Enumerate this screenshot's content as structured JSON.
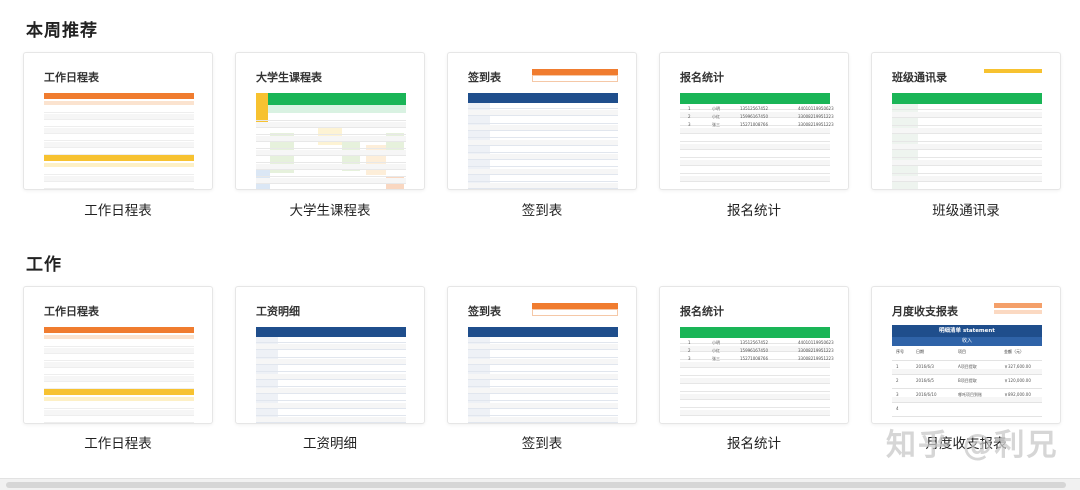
{
  "sections": [
    {
      "title": "本周推荐",
      "cards": [
        {
          "label": "工作日程表",
          "thumb_title": "工作日程表",
          "thumb_kind": "schedule"
        },
        {
          "label": "大学生课程表",
          "thumb_title": "大学生课程表",
          "thumb_kind": "timetable"
        },
        {
          "label": "签到表",
          "thumb_title": "签到表",
          "thumb_kind": "signin"
        },
        {
          "label": "报名统计",
          "thumb_title": "报名统计",
          "thumb_kind": "signup"
        },
        {
          "label": "班级通讯录",
          "thumb_title": "班级通讯录",
          "thumb_kind": "contacts"
        }
      ]
    },
    {
      "title": "工作",
      "cards": [
        {
          "label": "工作日程表",
          "thumb_title": "工作日程表",
          "thumb_kind": "schedule"
        },
        {
          "label": "工资明细",
          "thumb_title": "工资明细",
          "thumb_kind": "salary"
        },
        {
          "label": "签到表",
          "thumb_title": "签到表",
          "thumb_kind": "signin"
        },
        {
          "label": "报名统计",
          "thumb_title": "报名统计",
          "thumb_kind": "signup"
        },
        {
          "label": "月度收支报表",
          "thumb_title": "月度收支报表",
          "thumb_kind": "monthly"
        }
      ]
    }
  ],
  "monthly_thumb": {
    "header": "明细清单 statement",
    "subheader": "收入",
    "columns": [
      "序号",
      "日期",
      "项目",
      "金额（元）"
    ],
    "rows": [
      [
        "1",
        "2016/6/3",
        "A项目提取",
        "￥327,600.00"
      ],
      [
        "2",
        "2016/6/5",
        "B项目提取",
        "￥120,000.00"
      ],
      [
        "3",
        "2016/6/10",
        "哪吒项目到账",
        "￥892,000.00"
      ],
      [
        "4",
        "",
        "",
        ""
      ]
    ]
  },
  "signup_thumb": {
    "rows": [
      [
        "1",
        "小明",
        "13512567452",
        "44010119950623"
      ],
      [
        "2",
        "小红",
        "15996167450",
        "33008219951223"
      ],
      [
        "3",
        "张三",
        "15271008766",
        "33008219951223"
      ]
    ]
  },
  "watermark": "知乎 @利兄",
  "colors": {
    "orange": "#f07c2f",
    "yellow": "#f7c230",
    "green": "#1ab557",
    "navy": "#1f4e8c",
    "salmon": "#f4a06a"
  }
}
